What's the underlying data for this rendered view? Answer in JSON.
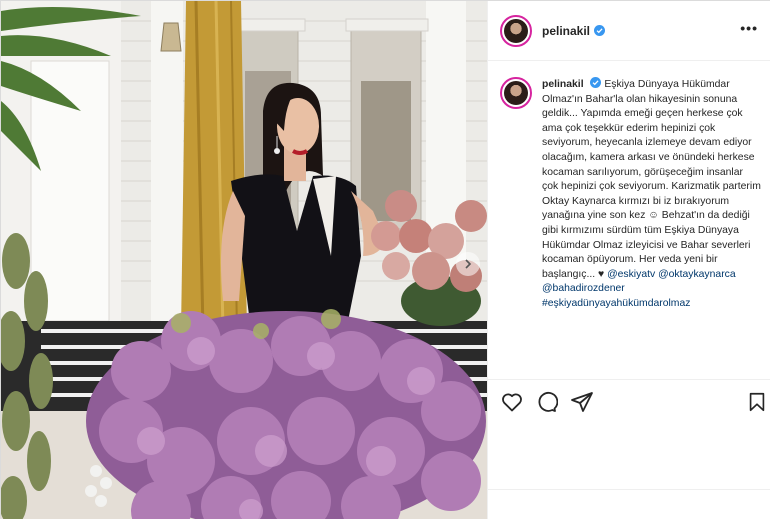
{
  "post": {
    "username": "pelinakil",
    "caption": {
      "user": "pelinakil",
      "text": "Eşkiya Dünyaya Hükümdar Olmaz'ın Bahar'la olan hikayesinin sonuna geldik... Yapımda emeği geçen herkese çok ama çok teşekkür ederim hepinizi çok seviyorum, heyecanla izlemeye devam ediyor olacağım, kamera arkası ve önündeki herkese kocaman sarılıyorum, görüşeceğim insanlar çok hepinizi çok seviyorum. Karizmatik parterim Oktay Kaynarca kırmızı bi iz bırakıyorum yanağına yine son kez ☺ Behzat'ın da dediği gibi kırmızımı sürdüm tüm Eşkiya Dünyaya Hükümdar Olmaz izleyicisi ve Bahar severleri kocaman öpüyorum. Her veda yeni bir başlangıç... ♥",
      "mention1": "@eskiyatv",
      "mention2": "@oktaykaynarca",
      "mention3": "@bahadirozdener",
      "hashtag": "#eşkiyadünyayahükümdarolmaz"
    },
    "more_label": "•••",
    "comment_placeholder": ""
  },
  "icons": {
    "verified": "verified-badge-icon",
    "like": "heart-icon",
    "comment": "comment-bubble-icon",
    "share": "paper-plane-icon",
    "save": "bookmark-icon",
    "carousel_next": "chevron-right-icon",
    "more": "ellipsis-icon"
  },
  "colors": {
    "verified": "#3897f0",
    "link": "#00376b",
    "text": "#262626",
    "border": "#efefef",
    "story_ring": "#d6249f"
  }
}
